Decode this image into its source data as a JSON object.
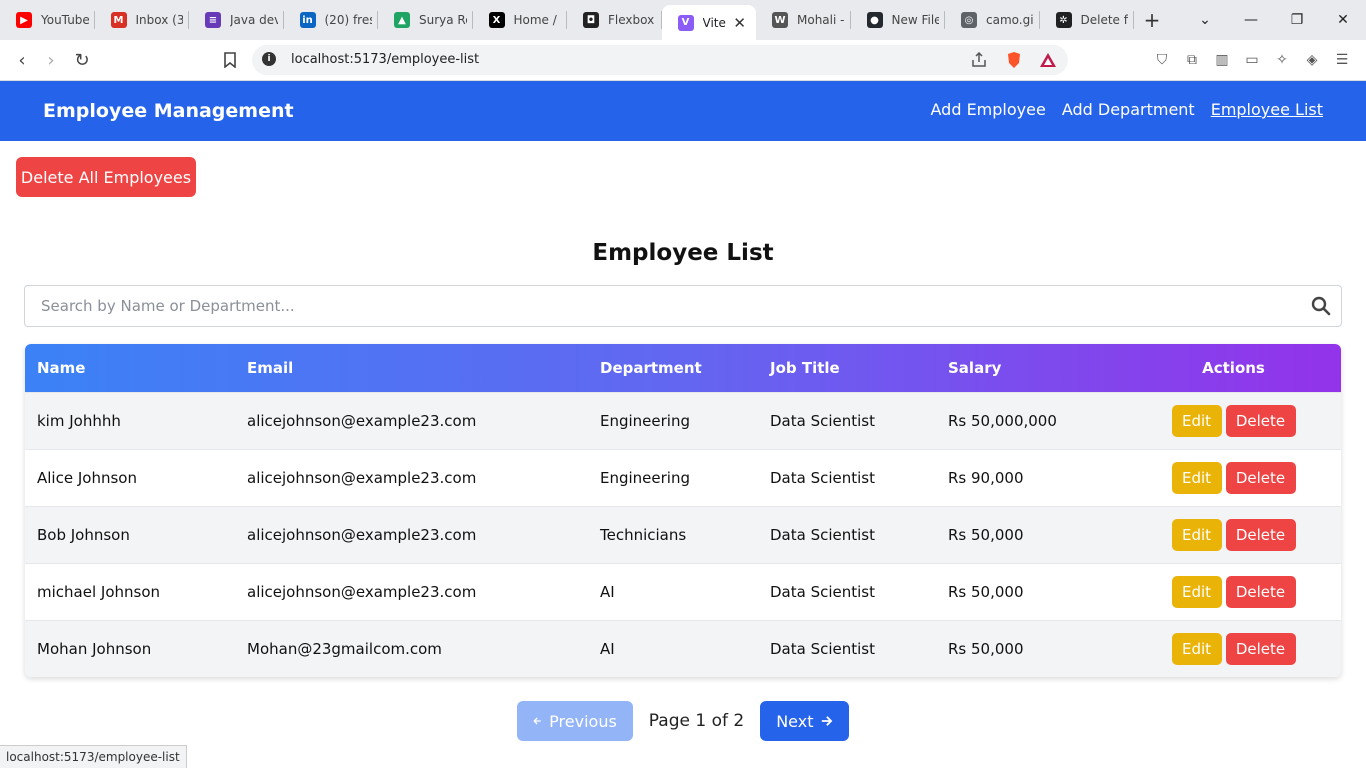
{
  "browser": {
    "tabs": [
      {
        "label": "YouTube",
        "icon": "youtube-icon",
        "color": "#ff0000",
        "glyph": "▶"
      },
      {
        "label": "Inbox (3",
        "icon": "gmail-icon",
        "color": "#d93025",
        "glyph": "M"
      },
      {
        "label": "Java dev",
        "icon": "forms-icon",
        "color": "#673ab7",
        "glyph": "≡"
      },
      {
        "label": "(20) fres",
        "icon": "linkedin-icon",
        "color": "#0a66c2",
        "glyph": "in"
      },
      {
        "label": "Surya Re",
        "icon": "drive-icon",
        "color": "#1fa463",
        "glyph": "▲"
      },
      {
        "label": "Home /",
        "icon": "x-icon",
        "color": "#000000",
        "glyph": "X"
      },
      {
        "label": "Flexbox",
        "icon": "flexbox-icon",
        "color": "#222222",
        "glyph": "◘"
      },
      {
        "label": "Vite",
        "icon": "vite-icon",
        "color": "#8b5cf6",
        "glyph": "V",
        "active": true
      },
      {
        "label": "Mohali -",
        "icon": "wikipedia-icon",
        "color": "#555555",
        "glyph": "W"
      },
      {
        "label": "New File",
        "icon": "github-icon",
        "color": "#24292f",
        "glyph": "●"
      },
      {
        "label": "camo.gi",
        "icon": "globe-icon",
        "color": "#5f6368",
        "glyph": "◎"
      },
      {
        "label": "Delete fi",
        "icon": "chatgpt-icon",
        "color": "#202123",
        "glyph": "✲"
      }
    ],
    "url": "localhost:5173/employee-list",
    "status_url": "localhost:5173/employee-list"
  },
  "app": {
    "brand": "Employee Management",
    "nav": [
      {
        "label": "Add Employee"
      },
      {
        "label": "Add Department"
      },
      {
        "label": "Employee List",
        "current": true
      }
    ],
    "delete_all_label": "Delete All Employees",
    "title": "Employee List",
    "search_placeholder": "Search by Name or Department...",
    "columns": [
      "Name",
      "Email",
      "Department",
      "Job Title",
      "Salary",
      "Actions"
    ],
    "rows": [
      {
        "name": "kim Johhhh",
        "email": "alicejohnson@example23.com",
        "department": "Engineering",
        "job_title": "Data Scientist",
        "salary": "Rs 50,000,000"
      },
      {
        "name": "Alice Johnson",
        "email": "alicejohnson@example23.com",
        "department": "Engineering",
        "job_title": "Data Scientist",
        "salary": "Rs 90,000"
      },
      {
        "name": "Bob Johnson",
        "email": "alicejohnson@example23.com",
        "department": "Technicians",
        "job_title": "Data Scientist",
        "salary": "Rs 50,000"
      },
      {
        "name": "michael Johnson",
        "email": "alicejohnson@example23.com",
        "department": "AI",
        "job_title": "Data Scientist",
        "salary": "Rs 50,000"
      },
      {
        "name": "Mohan Johnson",
        "email": "Mohan@23gmailcom.com",
        "department": "AI",
        "job_title": "Data Scientist",
        "salary": "Rs 50,000"
      }
    ],
    "edit_label": "Edit",
    "delete_label": "Delete",
    "pagination": {
      "prev_label": "Previous",
      "next_label": "Next",
      "info": "Page 1 of 2"
    },
    "colors": {
      "primary": "#2563eb",
      "danger": "#ef4444",
      "edit": "#eab308",
      "gradient_start": "#3b82f6",
      "gradient_end": "#9333ea"
    }
  }
}
